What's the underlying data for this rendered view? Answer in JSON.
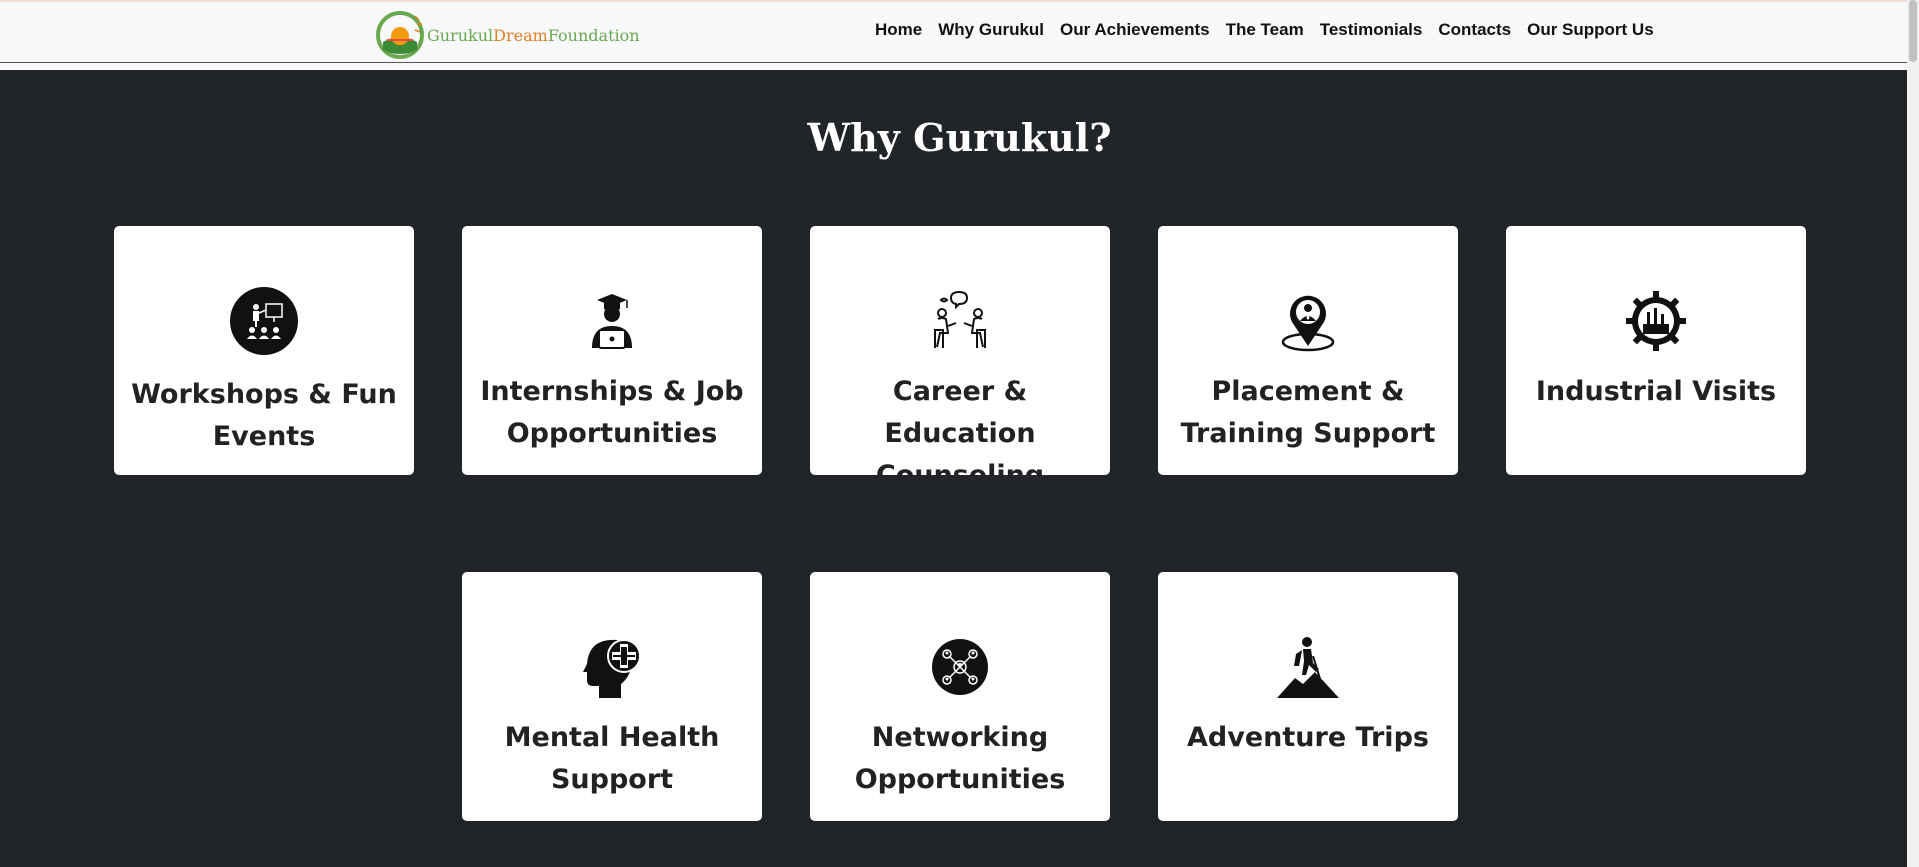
{
  "brand": {
    "part1": "Gurukul",
    "part2": "Dream",
    "part3": "Foundation",
    "colors": {
      "green": "#6aa84f",
      "orange": "#e67e22"
    }
  },
  "nav": {
    "items": [
      {
        "label": "Home"
      },
      {
        "label": "Why Gurukul"
      },
      {
        "label": "Our Achievements"
      },
      {
        "label": "The Team"
      },
      {
        "label": "Testimonials"
      },
      {
        "label": "Contacts"
      },
      {
        "label": "Our Support Us"
      }
    ]
  },
  "section": {
    "title": "Why Gurukul?",
    "background": "#212529",
    "cards": [
      {
        "title": "Workshops & Fun Events",
        "icon": "workshop-presentation-icon"
      },
      {
        "title": "Internships & Job Opportunities",
        "icon": "graduate-laptop-icon"
      },
      {
        "title": "Career & Education Counseling",
        "icon": "counseling-conversation-icon"
      },
      {
        "title": "Placement & Training Support",
        "icon": "location-pin-person-icon"
      },
      {
        "title": "Industrial Visits",
        "icon": "factory-gear-icon"
      },
      {
        "title": "Mental Health Support",
        "icon": "head-medical-cross-icon"
      },
      {
        "title": "Networking Opportunities",
        "icon": "people-network-icon"
      },
      {
        "title": "Adventure Trips",
        "icon": "hiker-mountain-icon"
      }
    ]
  }
}
